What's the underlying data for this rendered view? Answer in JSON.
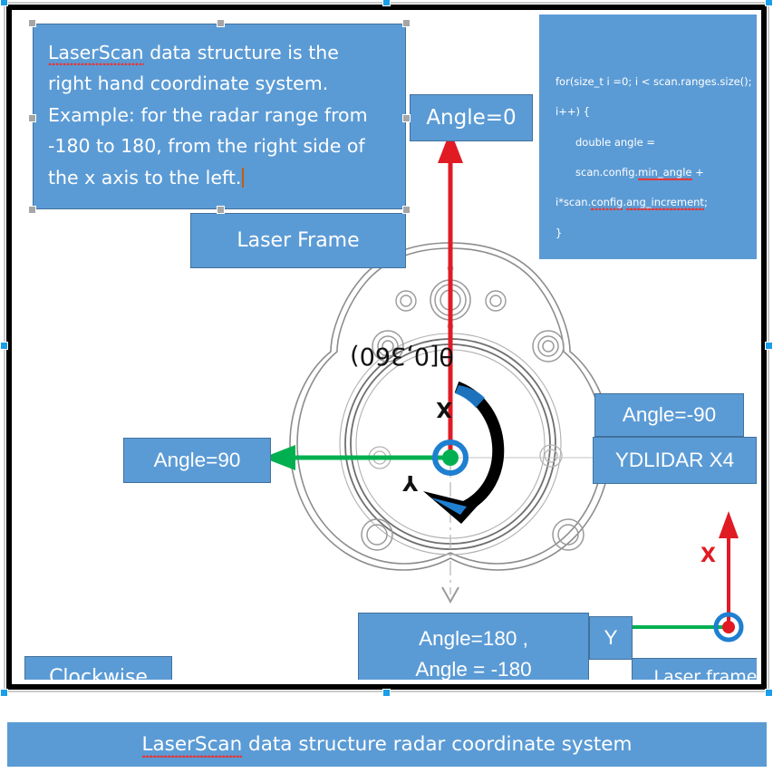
{
  "note": {
    "line1": "LaserScan data structure is the",
    "line2": "right hand coordinate system.",
    "line3": "Example: for the radar range from",
    "line4": "-180 to 180, from the right side of",
    "line5": "the x axis to the left.",
    "misspelled_word": "LaserScan"
  },
  "code": {
    "line1_a": "for(size_t i =0; i < scan.ranges.size(); i++) {",
    "line2_a": "double angle = scan.config.",
    "line2_b": "min_angle",
    "line2_c": " +",
    "line3_a": "i*scan.",
    "line3_b": "config",
    "line3_c": ".",
    "line3_d": "ang_increment",
    "line3_e": ";",
    "line4": "}"
  },
  "labels": {
    "angle_0": "Angle=0",
    "laser_frame": "Laser Frame",
    "angle_90": "Angle=90",
    "angle_minus_90": "Angle=-90",
    "ydlidar": "YDLIDAR X4",
    "angle_180_line1": "Angle=180 ,",
    "angle_180_line2": "Angle = -180",
    "y_axis": "Y",
    "laser_frame_2": "Laser frame",
    "clockwise": "Clockwise"
  },
  "diagram": {
    "theta_range": "θ[0,360)",
    "axis_x": "X",
    "axis_y": "Y",
    "mini_axis_x": "X",
    "mini_axis_y": "Y"
  },
  "caption": {
    "prefix": "LaserScan",
    "rest": " data structure radar coordinate system",
    "full": "LaserScan data structure radar coordinate system"
  },
  "colors": {
    "callout_blue": "#5B9BD5",
    "callout_border": "#41719C",
    "arrow_red": "#E01B24",
    "arrow_green": "#00B050",
    "origin_ring_blue": "#1F7FD0",
    "selection_handle": "#1A9EE8",
    "spell_underline": "#E03A3A"
  }
}
